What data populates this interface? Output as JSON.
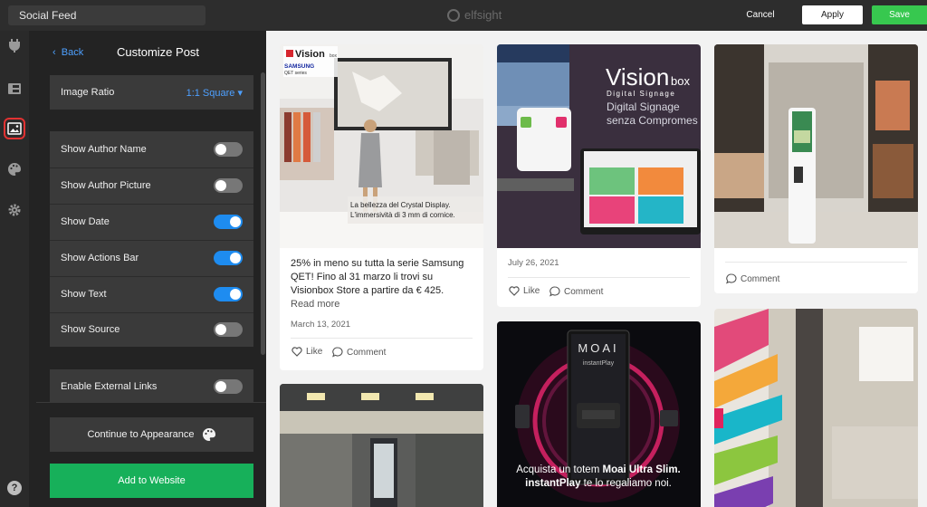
{
  "app": {
    "widget_name": "Social Feed",
    "brand": "elfsight",
    "cancel_label": "Cancel",
    "apply_label": "Apply",
    "save_label": "Save"
  },
  "rail": {
    "items": [
      {
        "icon": "plug-icon",
        "active": false
      },
      {
        "icon": "layout-icon",
        "active": false
      },
      {
        "icon": "image-icon",
        "active": true
      },
      {
        "icon": "palette-icon",
        "active": false
      },
      {
        "icon": "gear-icon",
        "active": false
      }
    ],
    "help_label": "?"
  },
  "panel": {
    "back_label": "Back",
    "title": "Customize Post",
    "image_ratio": {
      "label": "Image Ratio",
      "value": "1:1 Square"
    },
    "toggles": [
      {
        "label": "Show Author Name",
        "on": false
      },
      {
        "label": "Show Author Picture",
        "on": false
      },
      {
        "label": "Show Date",
        "on": true
      },
      {
        "label": "Show Actions Bar",
        "on": true
      },
      {
        "label": "Show Text",
        "on": true
      },
      {
        "label": "Show Source",
        "on": false
      }
    ],
    "external_links": {
      "label": "Enable External Links",
      "on": false
    },
    "continue_label": "Continue to Appearance",
    "add_label": "Add to Website"
  },
  "posts": [
    {
      "image_caption_line1": "La bellezza del Crystal Display.",
      "image_caption_line2": "L'immersività di 3 mm di cornice.",
      "logo_text": "Vision",
      "logo_sub": "box",
      "brand_text": "SAMSUNG",
      "series_text": "QET series",
      "text_lines": [
        "25% in meno su tutta la serie Samsung",
        "QET! Fino al 31 marzo li trovi su",
        "Visionbox Store a partire da € 425."
      ],
      "read_more": "Read more",
      "date": "March 13, 2021",
      "like_label": "Like",
      "comment_label": "Comment"
    },
    {
      "logo_text": "Vision",
      "logo_sub": "box",
      "tagline1": "Digital Signage",
      "tagline2": "Digital Signage",
      "tagline3": "senza Compromes",
      "date": "July 26, 2021",
      "like_label": "Like",
      "comment_label": "Comment"
    },
    {
      "comment_label": "Comment"
    },
    {
      "screen_title": "MOAI",
      "screen_sub": "instantPlay",
      "caption_line1_plain": "Acquista un totem ",
      "caption_line1_bold": "Moai Ultra Slim.",
      "caption_line2_bold": "instantPlay",
      "caption_line2_plain": " te lo regaliamo noi."
    },
    {},
    {}
  ],
  "colors": {
    "accent_blue": "#1e8cf0",
    "save_green": "#37c84f",
    "add_green": "#17b05a",
    "highlight_red": "#e23232"
  }
}
